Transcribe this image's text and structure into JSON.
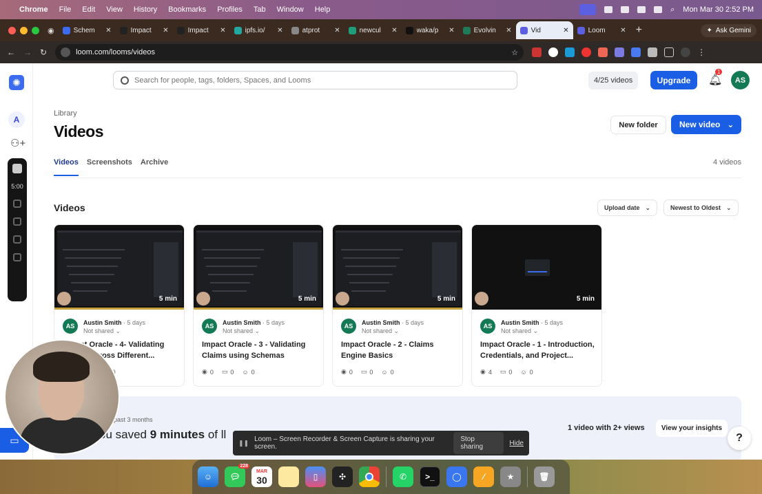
{
  "menubar": {
    "app": "Chrome",
    "items": [
      "File",
      "Edit",
      "View",
      "History",
      "Bookmarks",
      "Profiles",
      "Tab",
      "Window",
      "Help"
    ],
    "clock": "Mon Mar 30  2:52 PM"
  },
  "tabs": [
    {
      "title": "Schem",
      "color": "#3b6cf0"
    },
    {
      "title": "Impact",
      "color": "#222222"
    },
    {
      "title": "Impact",
      "color": "#222222"
    },
    {
      "title": "ipfs.io/",
      "color": "#22a8a0"
    },
    {
      "title": "atprot",
      "color": "#888888"
    },
    {
      "title": "newcul",
      "color": "#1e9e7a"
    },
    {
      "title": "waka/p",
      "color": "#111111"
    },
    {
      "title": "Evolvin",
      "color": "#1f7a5a"
    },
    {
      "title": "Vid",
      "color": "#5b5fe0",
      "active": true
    },
    {
      "title": "Loom",
      "color": "#5b5fe0"
    }
  ],
  "gemini_label": "Ask Gemini",
  "url": "loom.com/looms/videos",
  "search": {
    "placeholder": "Search for people, tags, folders, Spaces, and Looms"
  },
  "header": {
    "quota": "4/25 videos",
    "upgrade": "Upgrade",
    "notifications": "1",
    "user_initials": "AS"
  },
  "rail": {
    "workspace_initial": "A",
    "timer": "5:00"
  },
  "library": {
    "breadcrumb": "Library",
    "title": "Videos",
    "new_folder": "New folder",
    "new_video": "New video",
    "tabs": [
      "Videos",
      "Screenshots",
      "Archive"
    ],
    "count": "4 videos",
    "section_title": "Videos",
    "sort_field": "Upload date",
    "sort_order": "Newest to Oldest"
  },
  "videos": [
    {
      "title": "Impact Oracle - 4- Validating Claims Across Different...",
      "author": "Austin Smith",
      "age": "5 days",
      "sharing": "Not shared",
      "duration": "5 min",
      "views": "0",
      "comments": "0",
      "reactions": "0"
    },
    {
      "title": "Impact Oracle - 3 - Validating Claims using Schemas",
      "author": "Austin Smith",
      "age": "5 days",
      "sharing": "Not shared",
      "duration": "5 min",
      "views": "0",
      "comments": "0",
      "reactions": "0"
    },
    {
      "title": "Impact Oracle - 2 - Claims Engine Basics",
      "author": "Austin Smith",
      "age": "5 days",
      "sharing": "Not shared",
      "duration": "5 min",
      "views": "0",
      "comments": "0",
      "reactions": "0"
    },
    {
      "title": "Impact Oracle - 1 - Introduction, Credentials, and Project...",
      "author": "Austin Smith",
      "age": "5 days",
      "sharing": "Not shared",
      "duration": "5 min",
      "views": "4",
      "comments": "0",
      "reactions": "0"
    }
  ],
  "insights": {
    "period": "past 3 months",
    "saved_prefix": "ou saved",
    "saved_value": "9 minutes",
    "saved_suffix": "of ll",
    "views_summary": "1 video with 2+ views",
    "cta": "View your insights"
  },
  "share_bar": {
    "message": "Loom – Screen Recorder & Screen Capture is sharing your screen.",
    "stop": "Stop sharing",
    "hide": "Hide"
  },
  "dock": {
    "calendar_month": "MAR",
    "calendar_day": "30",
    "messages_badge": "228"
  }
}
